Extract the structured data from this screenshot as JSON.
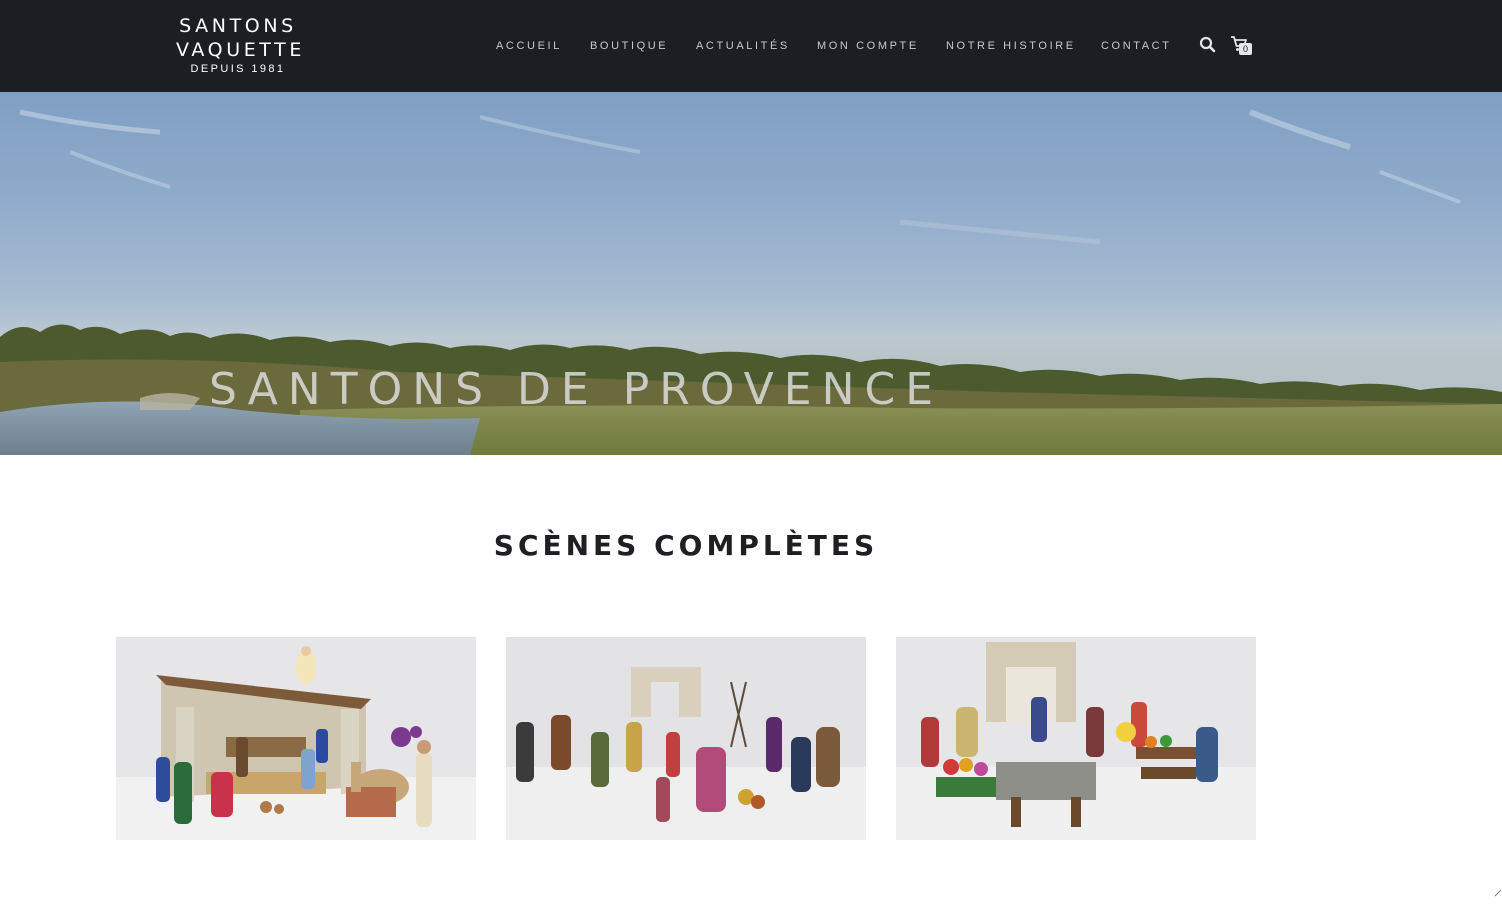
{
  "brand": {
    "line1": "SANTONS",
    "line2": "VAQUETTE",
    "tagline": "DEPUIS 1981"
  },
  "nav": {
    "items": [
      {
        "label": "ACCUEIL"
      },
      {
        "label": "BOUTIQUE"
      },
      {
        "label": "ACTUALITÉS"
      },
      {
        "label": "MON COMPTE"
      },
      {
        "label": "NOTRE HISTOIRE"
      },
      {
        "label": "CONTACT"
      }
    ],
    "search_icon": "search-icon",
    "cart_icon": "cart-icon",
    "cart_count": "0"
  },
  "hero": {
    "title": "SANTONS DE PROVENCE"
  },
  "section": {
    "title": "SCÈNES COMPLÈTES",
    "tiles": [
      {
        "subject": "nativity-scene"
      },
      {
        "subject": "village-scene"
      },
      {
        "subject": "market-scene"
      }
    ]
  },
  "colors": {
    "header_bg": "#1b1f24",
    "nav_text": "#c7cacd",
    "page_bg": "#ffffff",
    "heading": "#1d1f22"
  }
}
